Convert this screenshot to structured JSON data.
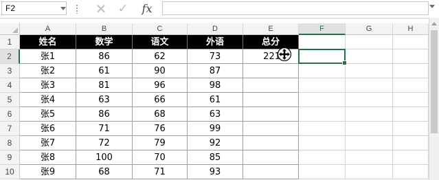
{
  "name_box": "F2",
  "formula_bar": {
    "cancel_icon": "cancel-icon",
    "enter_icon": "enter-icon",
    "fx_label": "fx",
    "value": ""
  },
  "columns": [
    "A",
    "B",
    "C",
    "D",
    "E",
    "F",
    "G",
    "H"
  ],
  "rows": [
    "1",
    "2",
    "3",
    "4",
    "5",
    "6",
    "7",
    "8",
    "9",
    "10"
  ],
  "active_cell": {
    "column": "F",
    "row": "2"
  },
  "table": {
    "header": [
      "姓名",
      "数学",
      "语文",
      "外语",
      "总分"
    ],
    "body": [
      [
        "张1",
        "86",
        "62",
        "73",
        "221"
      ],
      [
        "张2",
        "61",
        "90",
        "87",
        ""
      ],
      [
        "张3",
        "81",
        "96",
        "98",
        ""
      ],
      [
        "张4",
        "63",
        "66",
        "61",
        ""
      ],
      [
        "张5",
        "86",
        "68",
        "63",
        ""
      ],
      [
        "张6",
        "71",
        "76",
        "99",
        ""
      ],
      [
        "张7",
        "72",
        "79",
        "92",
        ""
      ],
      [
        "张8",
        "100",
        "70",
        "85",
        ""
      ],
      [
        "张9",
        "68",
        "71",
        "93",
        ""
      ]
    ]
  },
  "colors": {
    "header_bg": "#000000",
    "header_text": "#ffffff",
    "selection": "#217346"
  }
}
